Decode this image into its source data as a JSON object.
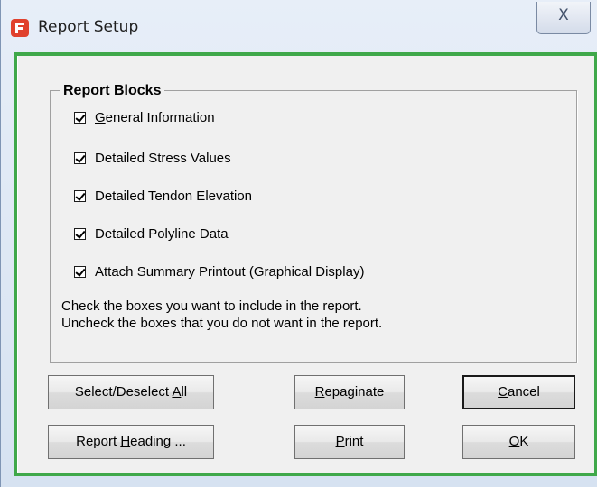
{
  "window": {
    "title": "Report Setup",
    "close_glyph": "X"
  },
  "group": {
    "title": "Report Blocks",
    "checkboxes": [
      {
        "label_mnemonic": "G",
        "label_rest": "eneral Information",
        "checked": true
      },
      {
        "label": "Detailed Stress Values",
        "checked": true
      },
      {
        "label": "Detailed Tendon Elevation",
        "checked": true
      },
      {
        "label": "Detailed Polyline Data",
        "checked": true
      },
      {
        "label": "Attach Summary Printout (Graphical Display)",
        "checked": true
      }
    ],
    "hint_line1": "Check the boxes you want to include in the report.",
    "hint_line2": "Uncheck the boxes that you do not want in the report."
  },
  "buttons": {
    "select_all": {
      "pre": "Select/Deselect ",
      "mnemonic": "A",
      "post": "ll"
    },
    "repaginate": {
      "mnemonic": "R",
      "post": "epaginate"
    },
    "cancel": {
      "mnemonic": "C",
      "post": "ancel"
    },
    "report_heading": {
      "pre": "Report ",
      "mnemonic": "H",
      "post": "eading ..."
    },
    "print": {
      "mnemonic": "P",
      "post": "rint"
    },
    "ok": {
      "mnemonic": "O",
      "post": "K"
    }
  },
  "icons": {
    "app_icon": "app-logo-icon",
    "close_icon": "close-icon"
  },
  "colors": {
    "frame_accent": "#3fa84a",
    "app_icon": "#e0412d",
    "dialog_background": "#f0f0f0"
  }
}
